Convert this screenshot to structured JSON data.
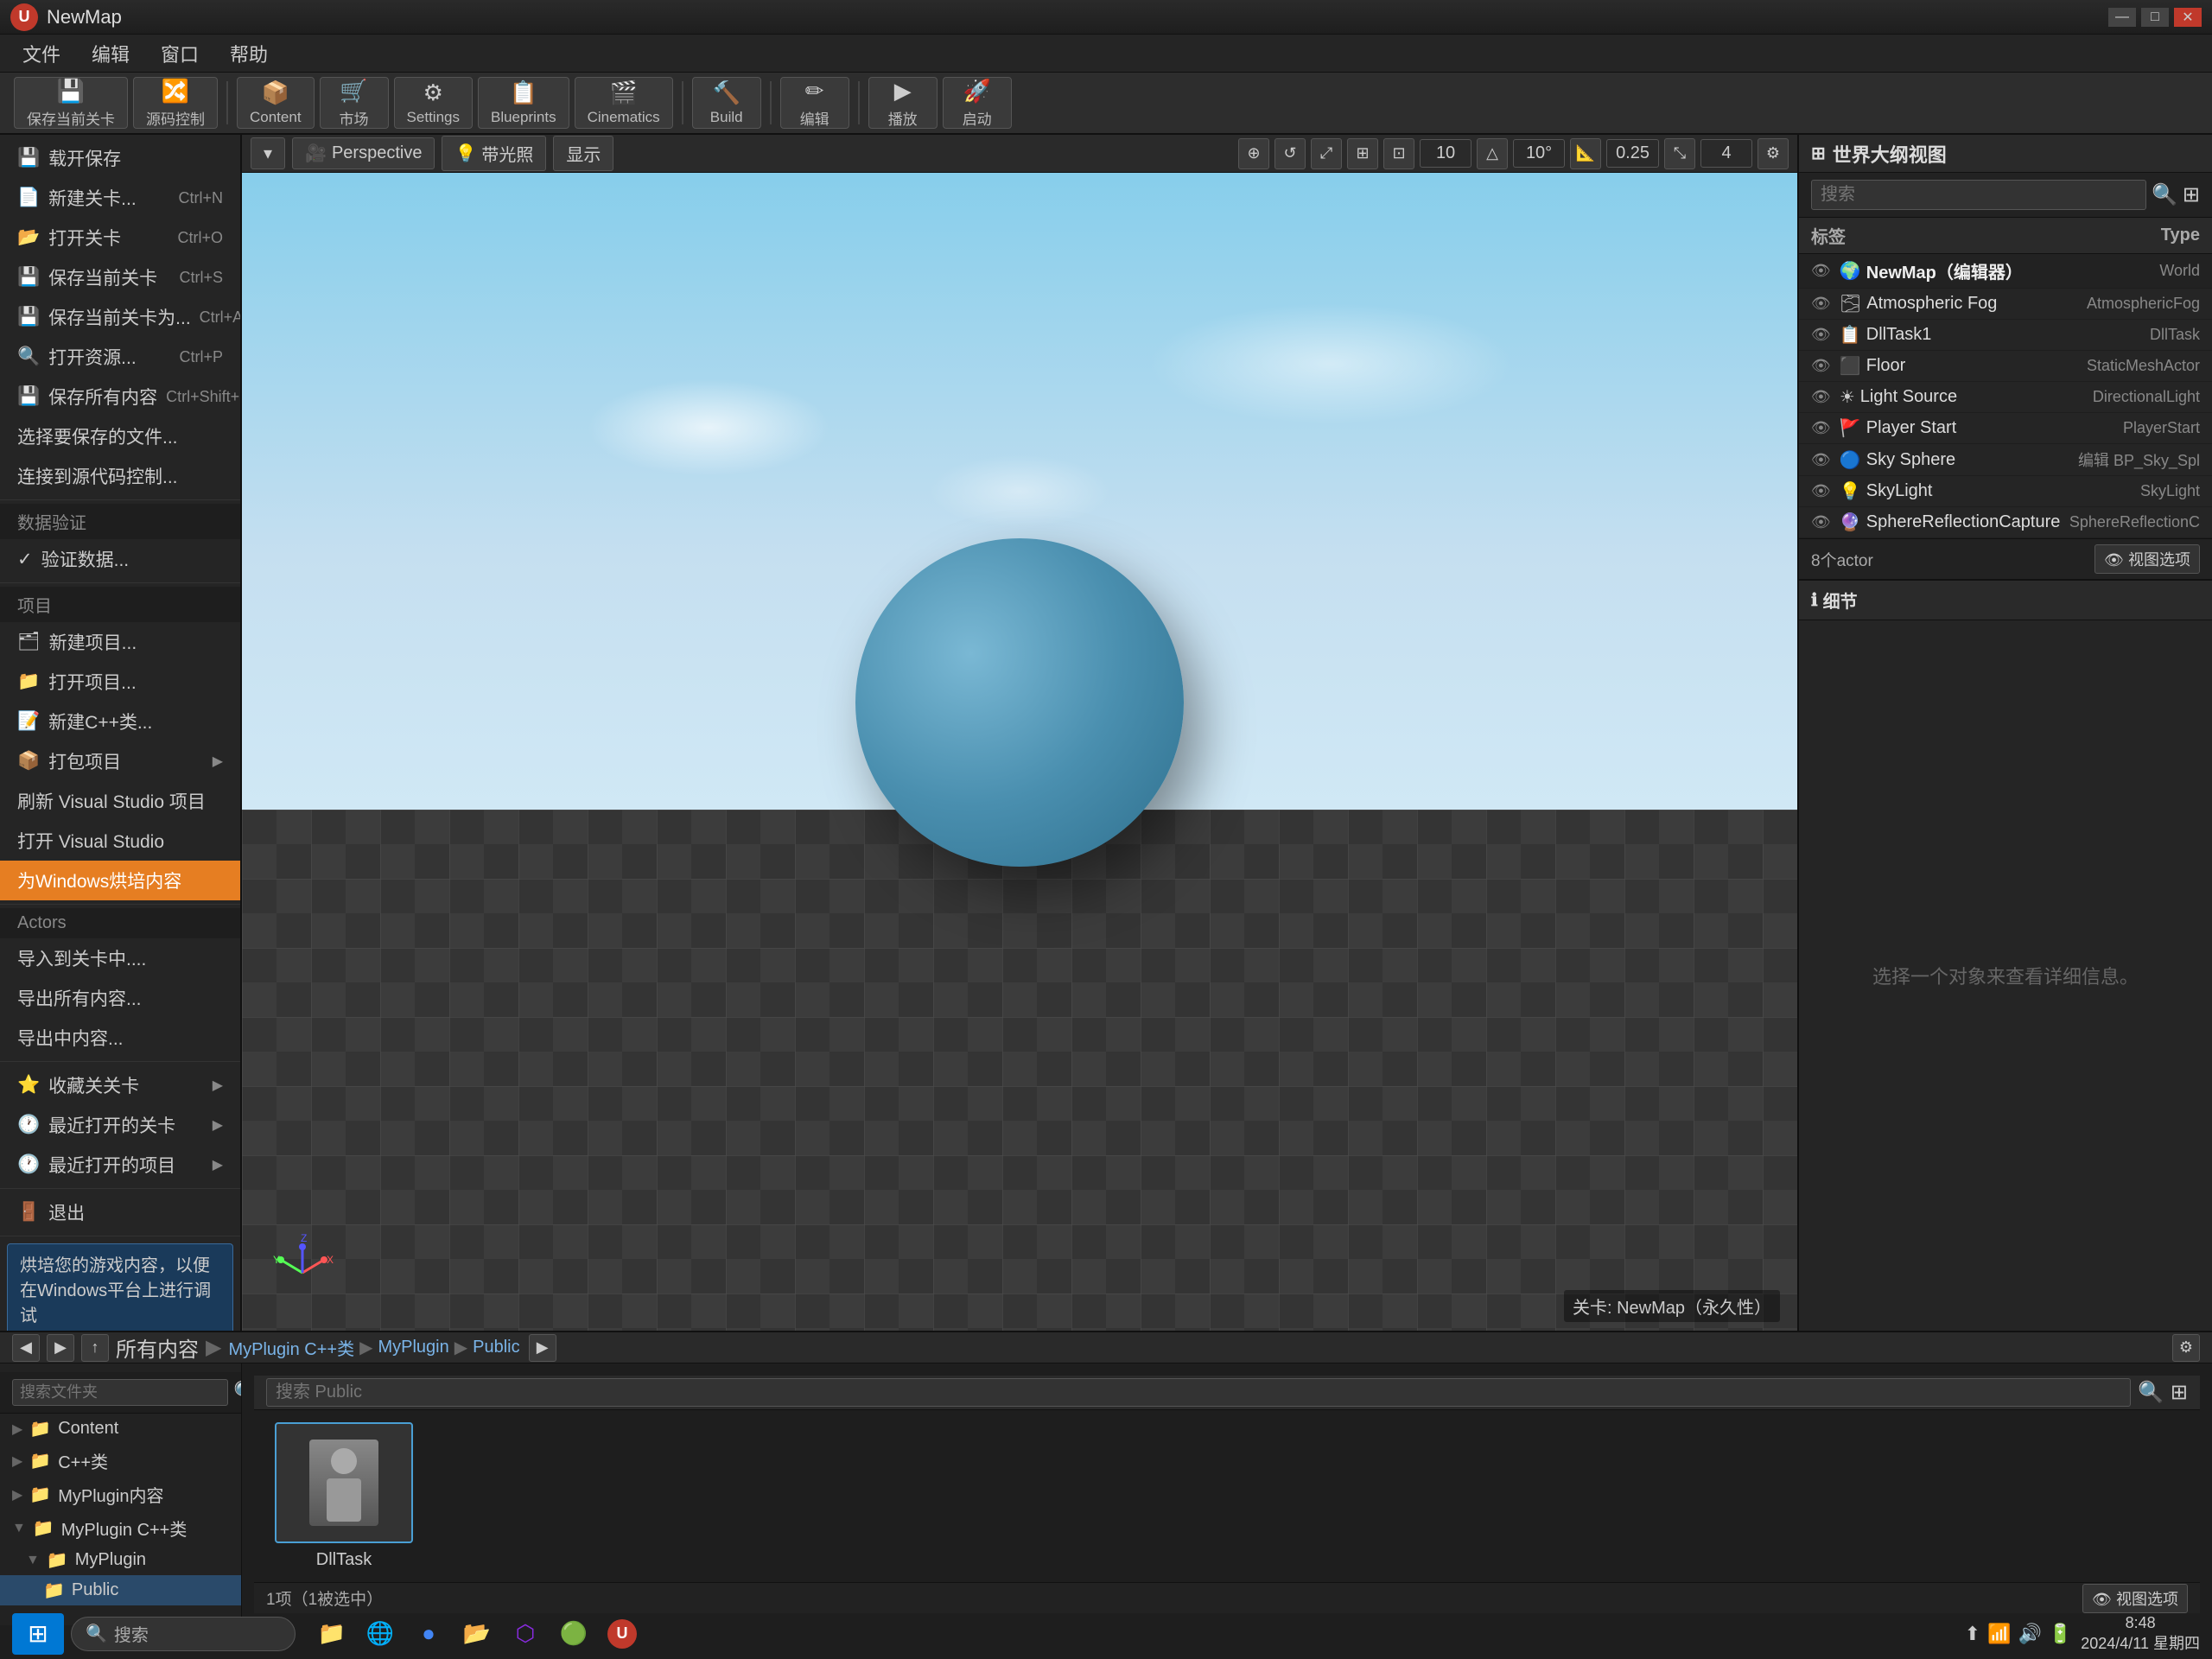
{
  "titlebar": {
    "logo": "U",
    "title": "NewMap",
    "controls": [
      "—",
      "□",
      "✕"
    ]
  },
  "menubar": {
    "items": [
      "文件",
      "编辑",
      "窗口",
      "帮助"
    ]
  },
  "toolbar": {
    "save_current_label": "保存当前关卡",
    "source_ctrl_label": "源码控制",
    "content_label": "Content",
    "market_label": "市场",
    "settings_label": "Settings",
    "blueprints_label": "Blueprints",
    "cinematics_label": "Cinematics",
    "build_label": "Build",
    "edit_label": "编辑",
    "play_label": "播放",
    "launch_label": "启动"
  },
  "left_menu": {
    "sections": [
      {
        "items": [
          {
            "label": "载开保存",
            "shortcut": ""
          },
          {
            "label": "新建关卡...",
            "shortcut": "Ctrl+N"
          },
          {
            "label": "打开关卡",
            "shortcut": "Ctrl+O"
          },
          {
            "label": "保存当前关卡",
            "shortcut": "Ctrl+S"
          },
          {
            "label": "保存当前关卡为...",
            "shortcut": "Ctrl+Alt+S"
          },
          {
            "label": "打开资源...",
            "shortcut": "Ctrl+P"
          },
          {
            "label": "保存所有内容",
            "shortcut": "Ctrl+Shift+S"
          },
          {
            "label": "选择要保存的文件...",
            "shortcut": ""
          },
          {
            "label": "连接到源代码控制...",
            "shortcut": ""
          }
        ]
      },
      {
        "header": "数据验证",
        "items": [
          {
            "label": "验证数据...",
            "shortcut": ""
          }
        ]
      },
      {
        "header": "项目",
        "items": [
          {
            "label": "新建项目...",
            "shortcut": ""
          },
          {
            "label": "打开项目...",
            "shortcut": ""
          },
          {
            "label": "新建C++类...",
            "shortcut": ""
          },
          {
            "label": "打包项目",
            "shortcut": "",
            "arrow": true
          },
          {
            "label": "刷新 Visual Studio 项目",
            "shortcut": ""
          },
          {
            "label": "打开 Visual Studio",
            "shortcut": ""
          },
          {
            "label": "为Windows烘培内容",
            "highlighted": true,
            "shortcut": ""
          }
        ]
      },
      {
        "header": "Actors",
        "items": [
          {
            "label": "导入到关卡中....",
            "shortcut": ""
          },
          {
            "label": "导出所有内容...",
            "shortcut": ""
          },
          {
            "label": "导出中内容...",
            "shortcut": ""
          }
        ]
      },
      {
        "items": [
          {
            "label": "收藏关关卡",
            "shortcut": "",
            "arrow": true
          },
          {
            "label": "最近打开的关卡",
            "shortcut": "",
            "arrow": true
          },
          {
            "label": "最近打开的项目",
            "shortcut": "",
            "arrow": true
          }
        ]
      },
      {
        "items": [
          {
            "label": "退出",
            "shortcut": ""
          }
        ]
      }
    ]
  },
  "viewport": {
    "mode_label": "Perspective",
    "light_btn": "带光照",
    "show_btn": "显示",
    "map_name": "关卡: NewMap（永久性）",
    "grid_size": "10",
    "angle": "10°",
    "scale": "0.25",
    "grid_count": "4"
  },
  "right_panel": {
    "title": "世界大纲视图",
    "search_placeholder": "搜索",
    "columns": {
      "label": "标签",
      "type": "Type"
    },
    "world_entry": {
      "name": "NewMap（编辑器）",
      "type": "World"
    },
    "actors": [
      {
        "name": "Atmospheric Fog",
        "type": "AtmosphericFog"
      },
      {
        "name": "DllTask1",
        "type": "DllTask"
      },
      {
        "name": "Floor",
        "type": "StaticMeshActor"
      },
      {
        "name": "Light Source",
        "type": "DirectionalLight"
      },
      {
        "name": "Player Start",
        "type": "PlayerStart"
      },
      {
        "name": "Sky Sphere",
        "type": "编辑 BP_Sky_Spl"
      },
      {
        "name": "SkyLight",
        "type": "SkyLight"
      },
      {
        "name": "SphereReflectionCapture",
        "type": "SphereReflectionC"
      }
    ],
    "footer_count": "8个actor",
    "view_button": "视图选项"
  },
  "details_panel": {
    "title": "细节",
    "empty_message": "选择一个对象来查看详细信息。"
  },
  "bottom_panel": {
    "all_content_label": "所有内容",
    "breadcrumb": [
      "MyPlugin C++类",
      "MyPlugin",
      "Public"
    ],
    "search_placeholder": "搜索 Public",
    "footer_count": "1项（1被选中）",
    "view_button": "视图选项",
    "content_items": [
      {
        "label": "DllTask",
        "selected": true
      }
    ]
  },
  "left_tree": {
    "nodes": [
      {
        "label": "Content",
        "expanded": false,
        "level": 0
      },
      {
        "label": "C++类",
        "expanded": false,
        "level": 0
      },
      {
        "label": "MyPlugin内容",
        "expanded": false,
        "level": 0
      },
      {
        "label": "MyPlugin C++类",
        "expanded": true,
        "level": 0
      },
      {
        "label": "MyPlugin",
        "expanded": true,
        "level": 1
      },
      {
        "label": "Public",
        "expanded": false,
        "level": 2,
        "selected": true
      }
    ]
  },
  "tooltip": {
    "text": "烘培您的游戏内容，以便在Windows平台上进行调试"
  },
  "taskbar": {
    "search_label": "搜索",
    "clock": "8:48",
    "date": "2024/4/11 星期四"
  }
}
